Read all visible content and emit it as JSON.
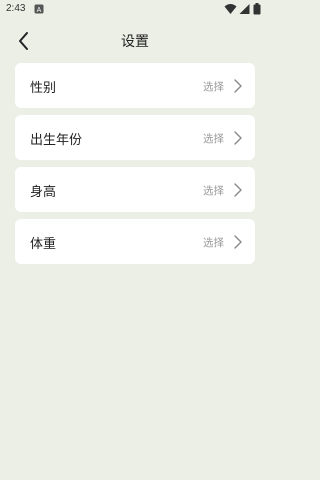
{
  "status_bar": {
    "time": "2:43",
    "icons": [
      "notification-a-icon",
      "wifi-icon",
      "signal-icon",
      "battery-icon"
    ]
  },
  "header": {
    "title": "设置",
    "back_icon": "chevron-left-icon"
  },
  "settings": [
    {
      "label": "性别",
      "value": "选择"
    },
    {
      "label": "出生年份",
      "value": "选择"
    },
    {
      "label": "身高",
      "value": "选择"
    },
    {
      "label": "体重",
      "value": "选择"
    }
  ],
  "colors": {
    "background": "#ecefe6",
    "card": "#ffffff",
    "hint_text": "#9a9a9a"
  }
}
